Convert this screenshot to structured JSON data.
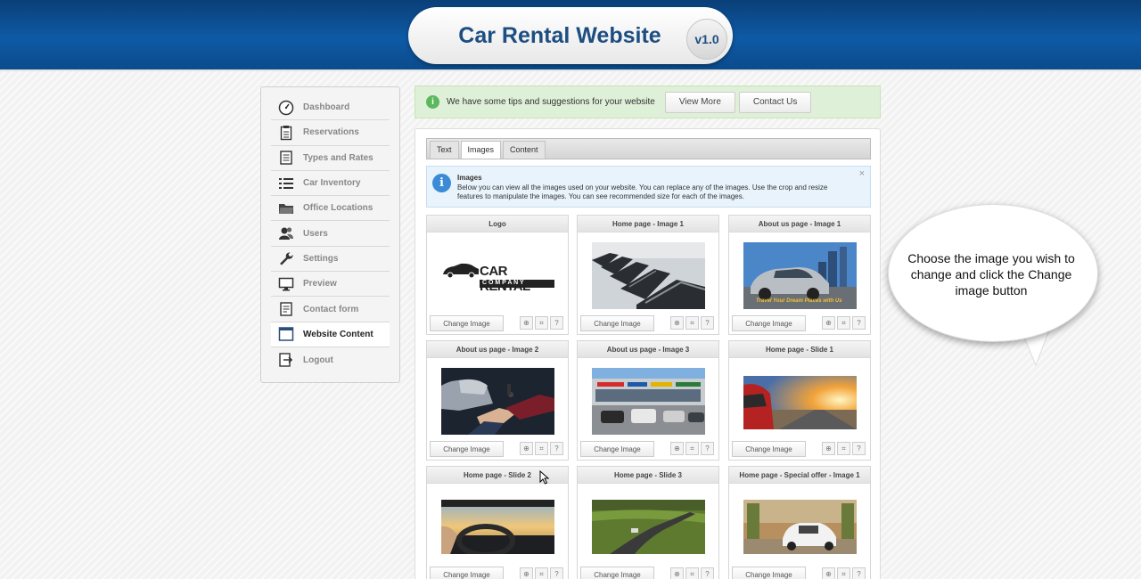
{
  "header": {
    "title": "Car Rental Website",
    "version": "v1.0"
  },
  "sidebar": {
    "items": [
      {
        "label": "Dashboard",
        "icon": "dashboard-gauge-icon"
      },
      {
        "label": "Reservations",
        "icon": "clipboard-icon"
      },
      {
        "label": "Types and Rates",
        "icon": "document-list-icon"
      },
      {
        "label": "Car Inventory",
        "icon": "list-icon"
      },
      {
        "label": "Office Locations",
        "icon": "folder-icon"
      },
      {
        "label": "Users",
        "icon": "users-icon"
      },
      {
        "label": "Settings",
        "icon": "wrench-icon"
      },
      {
        "label": "Preview",
        "icon": "monitor-icon"
      },
      {
        "label": "Contact form",
        "icon": "form-icon"
      },
      {
        "label": "Website Content",
        "icon": "window-icon",
        "active": true
      },
      {
        "label": "Logout",
        "icon": "logout-icon"
      }
    ]
  },
  "tips": {
    "text": "We have some tips and suggestions for your website",
    "view_more": "View More",
    "contact_us": "Contact Us"
  },
  "tabs": [
    "Text",
    "Images",
    "Content"
  ],
  "active_tab": "Images",
  "info": {
    "title": "Images",
    "body": "Below you can view all the images used on your website. You can replace any of the images. Use the crop and resize features to manipulate the images. You can see recommended size for each of the images.",
    "close": "×"
  },
  "cards": [
    {
      "title": "Logo",
      "button": "Change Image",
      "logo_line1": "CAR RENTAL",
      "logo_line2": "C O M P A N Y"
    },
    {
      "title": "Home page - Image 1",
      "button": "Change Image"
    },
    {
      "title": "About us page - Image 1",
      "button": "Change Image",
      "caption": "Travel Your Dream Places with Us"
    },
    {
      "title": "About us page - Image 2",
      "button": "Change Image"
    },
    {
      "title": "About us page - Image 3",
      "button": "Change Image"
    },
    {
      "title": "Home page - Slide 1",
      "button": "Change Image"
    },
    {
      "title": "Home page - Slide 2",
      "button": "Change Image"
    },
    {
      "title": "Home page - Slide 3",
      "button": "Change Image"
    },
    {
      "title": "Home page - Special offer - Image 1",
      "button": "Change Image"
    }
  ],
  "mini_buttons": {
    "resize": "⊕",
    "crop": "⌗",
    "help": "?"
  },
  "bubble": {
    "text": "Choose the image you wish to change and click the Change image button"
  },
  "colors": {
    "header_blue": "#0e5aa6",
    "title_blue": "#1d4e82",
    "tips_green": "#dff0d8",
    "info_blue": "#e8f3fb"
  }
}
